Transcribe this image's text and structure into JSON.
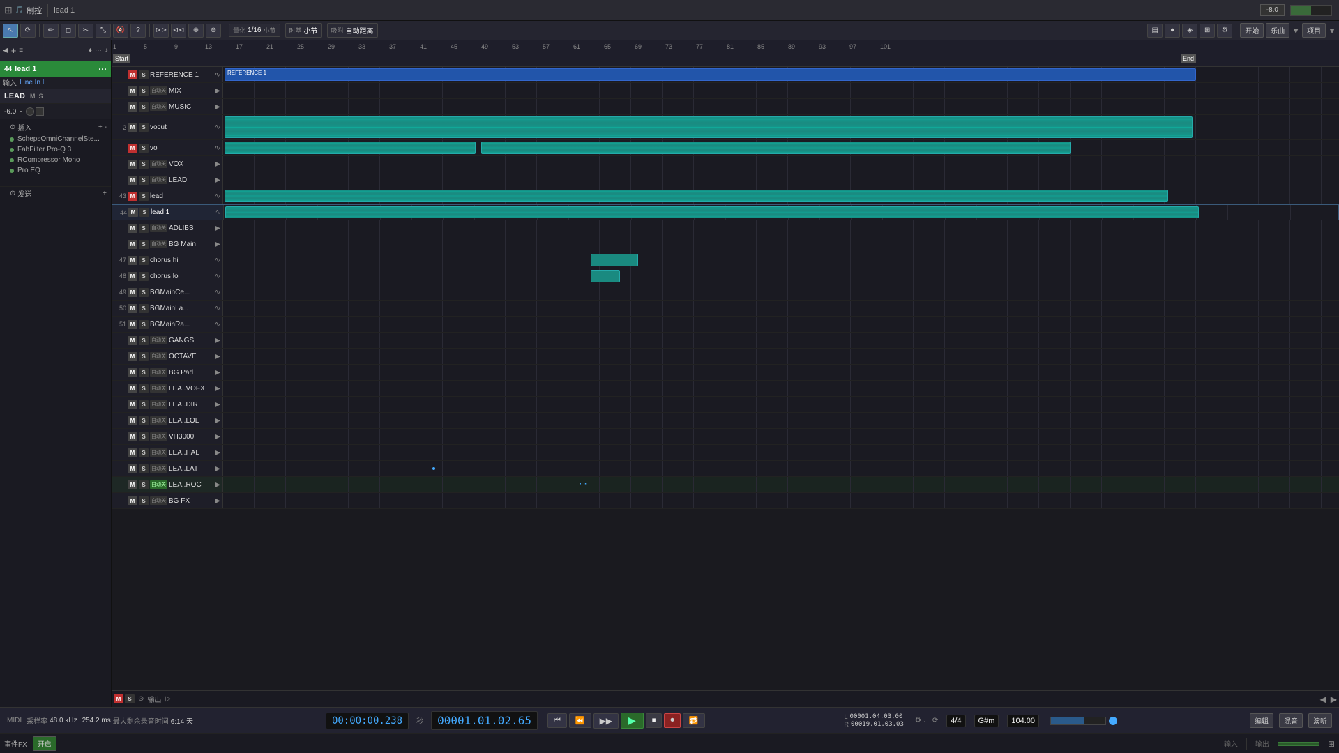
{
  "app": {
    "title": "制控",
    "project_name": "lead 1",
    "volume": "-8.0"
  },
  "toolbar": {
    "tools": [
      "arrow",
      "loop",
      "pencil",
      "eraser",
      "trim",
      "bounce",
      "mute",
      "question",
      "skip-fwd",
      "skip-back",
      "zoom",
      "magnify"
    ],
    "quantize": "1/16",
    "measure_label": "小节",
    "snap_label": "自动距离",
    "start_label": "开始",
    "song_label": "乐曲",
    "project_label": "项目"
  },
  "track_header": {
    "track_num": "44",
    "track_name": "lead 1",
    "input_label": "输入",
    "input_value": "Line In L",
    "group_label": "LEAD",
    "volume": "-6.0",
    "plugins": [
      "插入",
      "SchepsOmniChannelSte...",
      "FabFilter Pro-Q 3",
      "RCompressor Mono",
      "Pro EQ"
    ],
    "send_label": "发送"
  },
  "ruler": {
    "positions": [
      1,
      5,
      9,
      13,
      17,
      21,
      25,
      29,
      33,
      37,
      41,
      45,
      49,
      53,
      57,
      61,
      65,
      69,
      73,
      77,
      81,
      85,
      89,
      93,
      97,
      101
    ],
    "start": "Start",
    "end": "End"
  },
  "tracks": [
    {
      "id": 1,
      "num": "",
      "m": true,
      "m_red": true,
      "s": false,
      "auto": false,
      "name": "REFERENCE 1",
      "type": "audio",
      "has_clip": true,
      "clip_color": "blue",
      "clip_start": 0,
      "clip_width": 850
    },
    {
      "id": 2,
      "num": "",
      "m": false,
      "s": false,
      "auto": true,
      "name": "MIX",
      "type": "folder",
      "has_clip": false
    },
    {
      "id": 3,
      "num": "",
      "m": false,
      "s": false,
      "auto": true,
      "name": "MUSIC",
      "type": "folder",
      "has_clip": false
    },
    {
      "id": 4,
      "num": "2",
      "m": false,
      "s": false,
      "auto": false,
      "name": "vocut",
      "type": "audio",
      "has_clip": true,
      "clip_color": "teal",
      "clip_start": 0,
      "clip_width": 845
    },
    {
      "id": 5,
      "num": "",
      "m": true,
      "m_red": true,
      "s": false,
      "auto": false,
      "name": "vo",
      "type": "audio",
      "has_clip": true,
      "clip_color": "teal",
      "clip_start": 0,
      "clip_width": 730,
      "clip2_start": 740,
      "clip2_width": 340
    },
    {
      "id": 6,
      "num": "",
      "m": false,
      "s": false,
      "auto": true,
      "name": "VOX",
      "type": "folder",
      "has_clip": false
    },
    {
      "id": 7,
      "num": "",
      "m": false,
      "s": false,
      "auto": true,
      "name": "LEAD",
      "type": "folder",
      "has_clip": false
    },
    {
      "id": 8,
      "num": "43",
      "m": true,
      "m_red": true,
      "s": false,
      "auto": false,
      "name": "lead",
      "type": "audio",
      "has_clip": true,
      "clip_color": "teal",
      "clip_start": 0,
      "clip_width": 805
    },
    {
      "id": 9,
      "num": "44",
      "m": false,
      "s": false,
      "auto": false,
      "name": "lead 1",
      "type": "audio",
      "has_clip": true,
      "clip_color": "teal",
      "clip_start": 0,
      "clip_width": 855
    },
    {
      "id": 10,
      "num": "",
      "m": false,
      "s": false,
      "auto": true,
      "name": "ADLIBS",
      "type": "folder",
      "has_clip": false
    },
    {
      "id": 11,
      "num": "",
      "m": false,
      "s": false,
      "auto": true,
      "name": "BG Main",
      "type": "folder",
      "has_clip": false
    },
    {
      "id": 12,
      "num": "47",
      "m": false,
      "s": false,
      "auto": false,
      "name": "chorus hi",
      "type": "audio",
      "has_clip": true,
      "clip_color": "teal",
      "clip_start": 527,
      "clip_width": 65
    },
    {
      "id": 13,
      "num": "48",
      "m": false,
      "s": false,
      "auto": false,
      "name": "chorus lo",
      "type": "audio",
      "has_clip": true,
      "clip_color": "teal",
      "clip_start": 527,
      "clip_width": 40
    },
    {
      "id": 14,
      "num": "49",
      "m": false,
      "s": false,
      "auto": false,
      "name": "BGMainCe...",
      "type": "audio",
      "has_clip": false
    },
    {
      "id": 15,
      "num": "50",
      "m": false,
      "s": false,
      "auto": false,
      "name": "BGMainLa...",
      "type": "audio",
      "has_clip": false
    },
    {
      "id": 16,
      "num": "51",
      "m": false,
      "s": false,
      "auto": false,
      "name": "BGMainRa...",
      "type": "audio",
      "has_clip": false
    },
    {
      "id": 17,
      "num": "",
      "m": false,
      "s": false,
      "auto": true,
      "name": "GANGS",
      "type": "folder",
      "has_clip": false
    },
    {
      "id": 18,
      "num": "",
      "m": false,
      "s": false,
      "auto": true,
      "name": "OCTAVE",
      "type": "folder",
      "has_clip": false
    },
    {
      "id": 19,
      "num": "",
      "m": false,
      "s": false,
      "auto": true,
      "name": "BG Pad",
      "type": "folder",
      "has_clip": false
    },
    {
      "id": 20,
      "num": "",
      "m": false,
      "s": false,
      "auto": true,
      "name": "LEA..VOFX",
      "type": "folder",
      "has_clip": false
    },
    {
      "id": 21,
      "num": "",
      "m": false,
      "s": false,
      "auto": true,
      "name": "LEA..DIR",
      "type": "folder",
      "has_clip": false
    },
    {
      "id": 22,
      "num": "",
      "m": false,
      "s": false,
      "auto": true,
      "name": "LEA..LOL",
      "type": "folder",
      "has_clip": false
    },
    {
      "id": 23,
      "num": "",
      "m": false,
      "s": false,
      "auto": true,
      "name": "VH3000",
      "type": "folder",
      "has_clip": false
    },
    {
      "id": 24,
      "num": "",
      "m": false,
      "s": false,
      "auto": true,
      "name": "LEA..HAL",
      "type": "folder",
      "has_clip": false
    },
    {
      "id": 25,
      "num": "",
      "m": false,
      "s": false,
      "auto": true,
      "name": "LEA..LAT",
      "type": "folder",
      "has_clip": false
    },
    {
      "id": 26,
      "num": "",
      "m": false,
      "s": false,
      "auto": true,
      "name": "LEA..ROC",
      "type": "folder",
      "has_clip": false,
      "highlight": true
    },
    {
      "id": 27,
      "num": "",
      "m": false,
      "s": false,
      "auto": true,
      "name": "BG FX",
      "type": "folder",
      "has_clip": false
    }
  ],
  "transport": {
    "time_display": "00:00:00.238",
    "bar_display": "00001.01.02.65",
    "tempo": "104.00",
    "time_sig": "4/4",
    "key": "G#m",
    "sample_rate": "48.0 kHz",
    "bit_depth": "254.2 ms",
    "duration": "6:14 天",
    "pos_l": "00001.04.03.00",
    "pos_r": "00019.01.03.03"
  },
  "bottom": {
    "fx_label": "事件FX",
    "open_label": "开启",
    "input_label": "输入",
    "edit_label": "编辑",
    "mix_label": "混音",
    "preview_label": "演听"
  },
  "colors": {
    "track_bg": "#1a1a22",
    "clip_blue": "#2255aa",
    "clip_teal": "#1a8a80",
    "header_bg": "#1e1e28",
    "ruler_bg": "#1e1e2a",
    "transport_bg": "#222230"
  }
}
